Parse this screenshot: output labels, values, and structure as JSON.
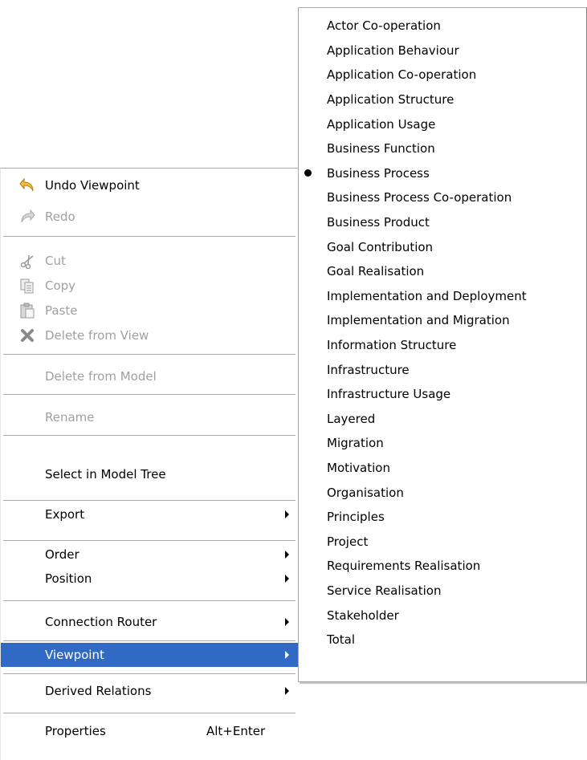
{
  "context_menu": {
    "undo": "Undo Viewpoint",
    "redo": "Redo",
    "cut": "Cut",
    "copy": "Copy",
    "paste": "Paste",
    "delete_from_view": "Delete from View",
    "delete_from_model": "Delete from Model",
    "rename": "Rename",
    "select_in_model_tree": "Select in Model Tree",
    "export": "Export",
    "order": "Order",
    "position": "Position",
    "connection_router": "Connection Router",
    "viewpoint": "Viewpoint",
    "derived_relations": "Derived Relations",
    "properties": "Properties",
    "properties_shortcut": "Alt+Enter"
  },
  "viewpoint_submenu": {
    "selected": "Business Process",
    "items": [
      "Actor Co-operation",
      "Application Behaviour",
      "Application Co-operation",
      "Application Structure",
      "Application Usage",
      "Business Function",
      "Business Process",
      "Business Process Co-operation",
      "Business Product",
      "Goal Contribution",
      "Goal Realisation",
      "Implementation and Deployment",
      "Implementation and Migration",
      "Information Structure",
      "Infrastructure",
      "Infrastructure Usage",
      "Layered",
      "Migration",
      "Motivation",
      "Organisation",
      "Principles",
      "Project",
      "Requirements Realisation",
      "Service Realisation",
      "Stakeholder",
      "Total"
    ]
  },
  "colors": {
    "selection": "#316ac5",
    "disabled_text": "#a0a0a0",
    "separator": "#a7a6aa"
  },
  "icons": {
    "undo": "undo-arrow-icon",
    "redo": "redo-arrow-icon",
    "cut": "scissors-icon",
    "copy": "copy-icon",
    "paste": "paste-clipboard-icon",
    "delete": "red-x-delete-icon",
    "submenu": "submenu-arrow-icon",
    "radio": "radio-bullet-icon"
  }
}
